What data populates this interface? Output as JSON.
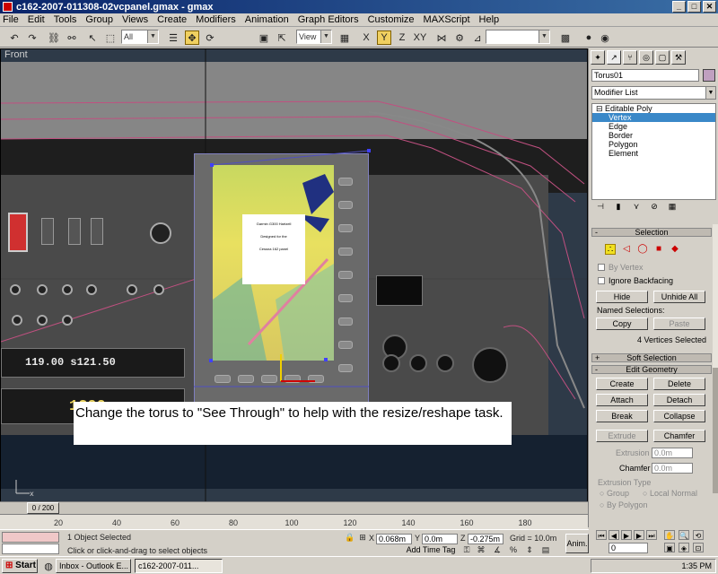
{
  "window": {
    "title": "c162-2007-011308-02vcpanel.gmax - gmax",
    "minimize": "_",
    "maximize": "□",
    "close": "✕"
  },
  "menu": [
    "File",
    "Edit",
    "Tools",
    "Group",
    "Views",
    "Create",
    "Modifiers",
    "Animation",
    "Graph Editors",
    "Customize",
    "MAXScript",
    "Help"
  ],
  "toolbar": {
    "selection_filter": "All",
    "ref_coord": "View",
    "named_selection": ""
  },
  "viewport": {
    "label": "Front",
    "gps_text": [
      "Garmin G300 Hartzell",
      "Designed for the",
      "Cessna 162 panel"
    ],
    "radio_top": "119.00  s121.50",
    "radio_bottom": "1200",
    "annotation": "Change the torus to \"See Through\" to help with the resize/reshape task."
  },
  "timeline": {
    "frame_counter": "0 / 200",
    "ruler_labels": [
      "20",
      "40",
      "60",
      "80",
      "100",
      "120",
      "140",
      "160",
      "180"
    ]
  },
  "status": {
    "selected": "1 Object Selected",
    "prompt": "Click or click-and-drag to select objects",
    "x_label": "X",
    "x_value": "0.068m",
    "y_label": "Y",
    "y_value": "0.0m",
    "z_label": "Z",
    "z_value": "-0.275m",
    "grid": "Grid = 10.0m",
    "add_time_tag": "Add Time Tag",
    "anim": "Anim.",
    "frame_field": "0"
  },
  "command_panel": {
    "object_name": "Torus01",
    "modifier_list": "Modifier List",
    "stack": {
      "root": "Editable Poly",
      "subs": [
        "Vertex",
        "Edge",
        "Border",
        "Polygon",
        "Element"
      ],
      "selected": "Vertex"
    },
    "selection": {
      "title": "Selection",
      "by_vertex": "By Vertex",
      "ignore_backfacing": "Ignore Backfacing",
      "hide": "Hide",
      "unhide_all": "Unhide All",
      "named_selections": "Named Selections:",
      "copy": "Copy",
      "paste": "Paste",
      "count": "4 Vertices Selected"
    },
    "soft_selection": "Soft Selection",
    "edit_geometry": {
      "title": "Edit Geometry",
      "create": "Create",
      "delete": "Delete",
      "attach": "Attach",
      "detach": "Detach",
      "break": "Break",
      "collapse": "Collapse",
      "extrude": "Extrude",
      "chamfer": "Chamfer",
      "extrusion_label": "Extrusion",
      "extrusion_value": "0.0m",
      "chamfer_label": "Chamfer",
      "chamfer_value": "0.0m",
      "extrusion_type": "Extrusion Type",
      "group": "Group",
      "local_normal": "Local Normal",
      "by_polygon": "By Polygon"
    }
  },
  "taskbar": {
    "start": "Start",
    "task1": "Inbox - Outlook E...",
    "task2": "c162-2007-011...",
    "clock": "1:35 PM"
  }
}
